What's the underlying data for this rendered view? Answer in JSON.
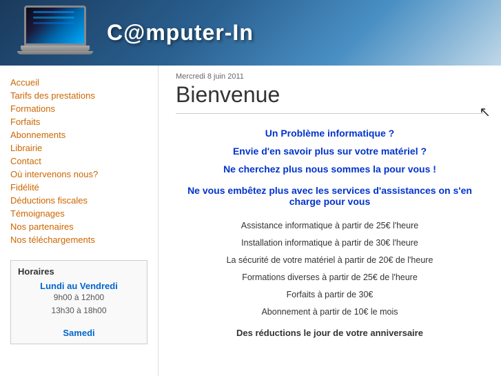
{
  "header": {
    "title": "C@mputer-In"
  },
  "nav": {
    "items": [
      {
        "label": "Accueil",
        "id": "accueil"
      },
      {
        "label": "Tarifs des prestations",
        "id": "tarifs"
      },
      {
        "label": "Formations",
        "id": "formations"
      },
      {
        "label": "Forfaits",
        "id": "forfaits"
      },
      {
        "label": "Abonnements",
        "id": "abonnements"
      },
      {
        "label": "Librairie",
        "id": "librairie"
      },
      {
        "label": "Contact",
        "id": "contact"
      },
      {
        "label": "Où intervenons nous?",
        "id": "ou"
      },
      {
        "label": "Fidélité",
        "id": "fidelite"
      },
      {
        "label": "Déductions fiscales",
        "id": "deductions"
      },
      {
        "label": "Témoignages",
        "id": "temoignages"
      },
      {
        "label": "Nos partenaires",
        "id": "partenaires"
      },
      {
        "label": "Nos téléchargements",
        "id": "telechargements"
      }
    ]
  },
  "horaires": {
    "title": "Horaires",
    "weekday_label": "Lundi au Vendredi",
    "weekday_hours1": "9h00 à 12h00",
    "weekday_hours2": "13h30 à 18h00",
    "saturday_label": "Samedi"
  },
  "content": {
    "date": "Mercredi 8 juin 2011",
    "title": "Bienvenue",
    "line1": "Un Problème informatique ?",
    "line2": "Envie d'en savoir plus sur votre matériel ?",
    "line3": "Ne cherchez plus nous sommes la pour vous !",
    "line4": "Ne vous embêtez plus avec les services d'assistances on s'en charge pour vous",
    "services": [
      "Assistance informatique à partir de 25€ l'heure",
      "Installation informatique à partir de 30€ l'heure",
      "La sécurité de votre matériel à partir de 20€ de l'heure",
      "Formations diverses à partir de 25€ de l'heure",
      "Forfaits à partir de 30€",
      "Abonnement à partir de 10€ le mois"
    ],
    "footer_note": "Des réductions le jour de votre anniversaire"
  }
}
